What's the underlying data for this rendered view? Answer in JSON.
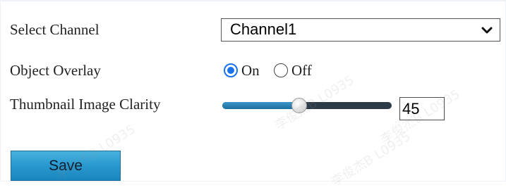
{
  "form": {
    "channel": {
      "label": "Select Channel",
      "value": "Channel1"
    },
    "overlay": {
      "label": "Object Overlay",
      "options": [
        {
          "label": "On",
          "checked": true
        },
        {
          "label": "Off",
          "checked": false
        }
      ]
    },
    "clarity": {
      "label": "Thumbnail Image Clarity",
      "value": "45",
      "fraction": 0.45
    },
    "save_label": "Save"
  },
  "colors": {
    "radio_accent": "#1a73e8",
    "slider_fill": "#2a86bd",
    "slider_track": "#2d3b48",
    "button": "#2a9ad0"
  },
  "icons": {
    "dropdown": "chevron-down-icon"
  }
}
